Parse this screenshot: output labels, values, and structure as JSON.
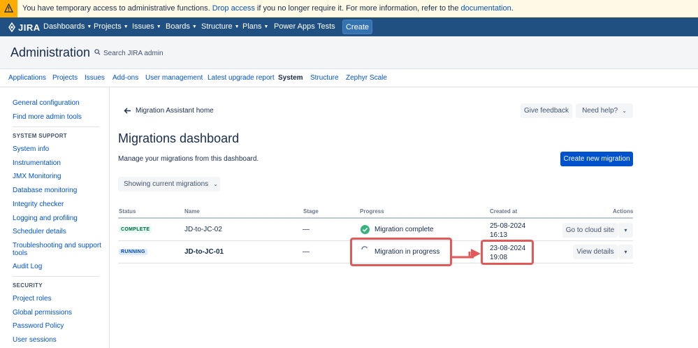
{
  "banner": {
    "text_before": "You have temporary access to administrative functions. ",
    "drop_link": "Drop access",
    "text_middle": " if you no longer require it. For more information, refer to the ",
    "doc_link": "documentation",
    "text_end": "."
  },
  "topnav": {
    "logo": "JIRA",
    "items": [
      "Dashboards",
      "Projects",
      "Issues",
      "Boards",
      "Structure",
      "Plans",
      "Power Apps",
      "Tests"
    ],
    "create_label": "Create"
  },
  "admin": {
    "title": "Administration",
    "search_placeholder": "Search JIRA admin"
  },
  "tabs": [
    "Applications",
    "Projects",
    "Issues",
    "Add-ons",
    "User management",
    "Latest upgrade report",
    "System",
    "Structure",
    "Zephyr Scale"
  ],
  "sidebar": {
    "top_links": [
      "General configuration",
      "Find more admin tools"
    ],
    "system_support_heading": "SYSTEM SUPPORT",
    "system_support": [
      "System info",
      "Instrumentation",
      "JMX Monitoring",
      "Database monitoring",
      "Integrity checker",
      "Logging and profiling",
      "Scheduler details",
      "Troubleshooting and support",
      "tools",
      "Audit Log"
    ],
    "security_heading": "SECURITY",
    "security": [
      "Project roles",
      "Global permissions",
      "Password Policy",
      "User sessions"
    ]
  },
  "main": {
    "back_label": "Migration Assistant home",
    "feedback_label": "Give feedback",
    "help_label": "Need help?",
    "title": "Migrations dashboard",
    "subtitle": "Manage your migrations from this dashboard.",
    "create_label": "Create new migration",
    "filter_label": "Showing current migrations"
  },
  "table": {
    "headers": [
      "Status",
      "Name",
      "Stage",
      "Progress",
      "Created at",
      "Actions"
    ],
    "rows": [
      {
        "status": "COMPLETE",
        "name": "JD-to-JC-02",
        "stage": "—",
        "progress": "Migration complete",
        "date": "25-08-2024",
        "time": "16:13",
        "action": "Go to cloud site"
      },
      {
        "status": "RUNNING",
        "name": "JD-to-JC-01",
        "stage": "—",
        "progress": "Migration in progress",
        "date": "23-08-2024",
        "time": "19:08",
        "action": "View details"
      }
    ]
  },
  "colors": {
    "nav": "#205081",
    "primary": "#0052cc",
    "annotation": "#e05a5a",
    "success": "#36b37e"
  }
}
